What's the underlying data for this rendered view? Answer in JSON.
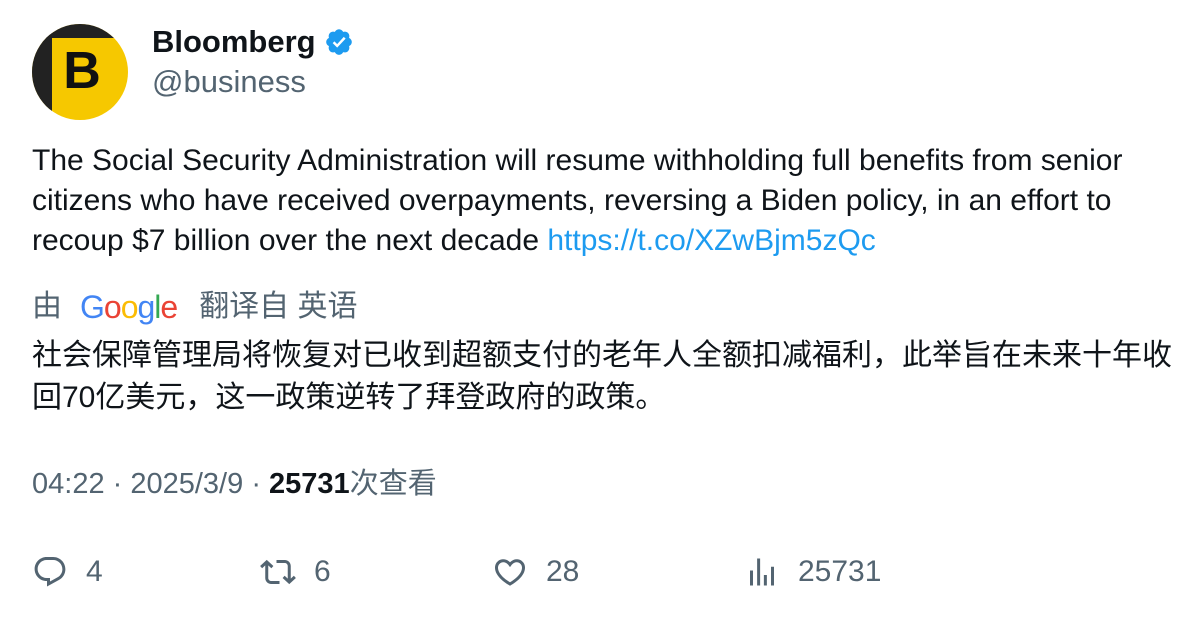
{
  "author": {
    "avatar_letter": "B",
    "name": "Bloomberg",
    "handle": "@business",
    "verified": true,
    "avatar_color": "#f6c800",
    "verified_color": "#1d9bf0"
  },
  "tweet": {
    "text": "The Social Security Administration will resume withholding full benefits from senior citizens who have received overpayments, reversing a Biden policy, in an effort to recoup $7 billion over the next decade",
    "link": "https://t.co/XZwBjm5zQc",
    "link_color": "#1d9bf0"
  },
  "translation": {
    "by_label": "由",
    "provider": "Google",
    "from_label": "翻译自 英语",
    "text": "社会保障管理局将恢复对已收到超额支付的老年人全额扣减福利，此举旨在未来十年收回70亿美元，这一政策逆转了拜登政府的政策。"
  },
  "meta": {
    "time": "04:22",
    "separator": "·",
    "date": "2025/3/9",
    "views_count": "25731",
    "views_label": "次查看"
  },
  "actions": {
    "replies": "4",
    "retweets": "6",
    "likes": "28",
    "views": "25731",
    "icon_color": "#536471"
  }
}
